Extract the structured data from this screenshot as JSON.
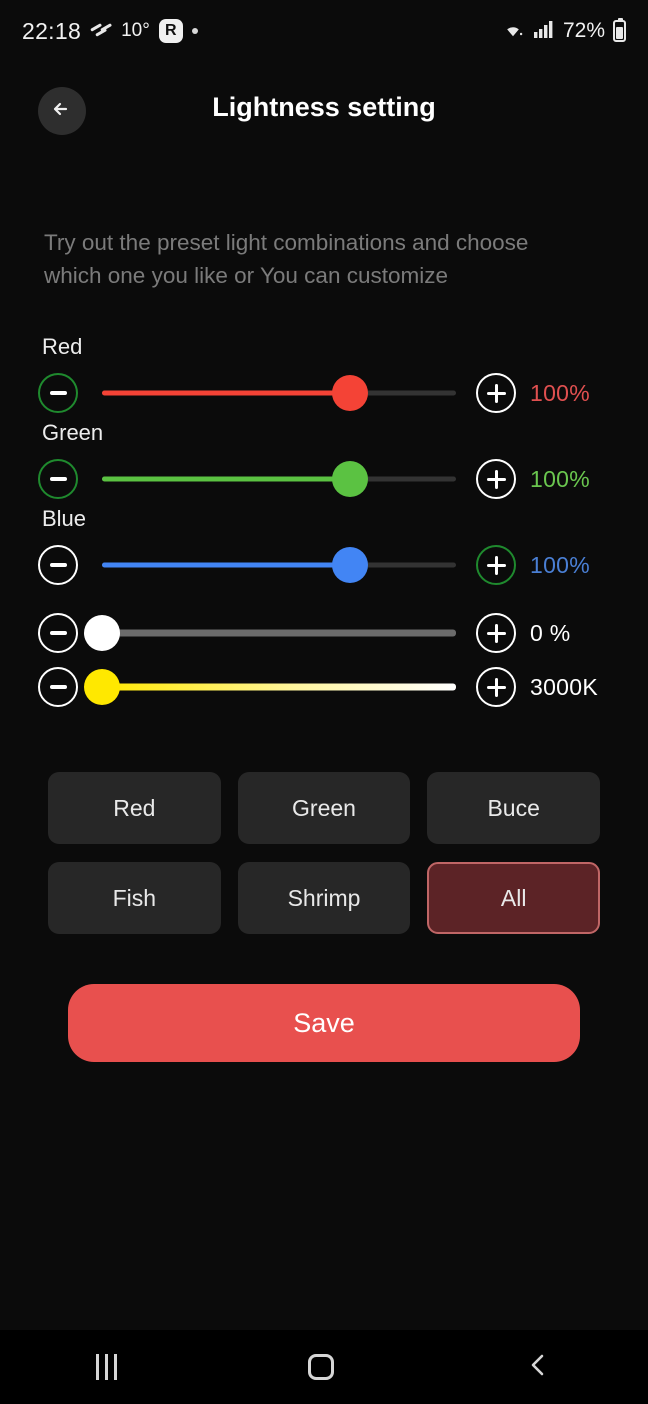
{
  "statusbar": {
    "time": "22:18",
    "weather_icon": "weather-haze-icon",
    "temperature": "10°",
    "app_badge": "R",
    "notification_dot": "•",
    "wifi_icon": "wifi-icon",
    "signal_icon": "cellular-signal-icon",
    "battery_percent": "72%",
    "battery_icon": "battery-icon"
  },
  "header": {
    "back_icon": "arrow-left-icon",
    "title": "Lightness setting"
  },
  "description": "Try out the preset light combinations and choose which one you like or You can customize",
  "sliders": [
    {
      "label": "Red",
      "value": "100%",
      "percent": 70,
      "color": "#f44336",
      "value_color": "#e05050",
      "minus_ring": "#1f8a2e",
      "plus_ring": "#ffffff",
      "minus_icon": "minus-icon",
      "plus_icon": "plus-icon"
    },
    {
      "label": "Green",
      "value": "100%",
      "percent": 70,
      "color": "#5bc242",
      "value_color": "#6ac64f",
      "minus_ring": "#1f8a2e",
      "plus_ring": "#ffffff",
      "minus_icon": "minus-icon",
      "plus_icon": "plus-icon"
    },
    {
      "label": "Blue",
      "value": "100%",
      "percent": 70,
      "color": "#4285f4",
      "value_color": "#4a7fd4",
      "minus_ring": "#ffffff",
      "plus_ring": "#1f8a2e",
      "minus_icon": "minus-icon",
      "plus_icon": "plus-icon"
    }
  ],
  "white_slider": {
    "label": "",
    "value": "0 %",
    "percent": 0,
    "thumb_color": "#ffffff",
    "track_color": "#6b6b6b",
    "value_color": "#ffffff",
    "minus_ring": "#ffffff",
    "plus_ring": "#ffffff",
    "minus_icon": "minus-icon",
    "plus_icon": "plus-icon"
  },
  "temperature_slider": {
    "label": "",
    "value": "3000K",
    "percent": 0,
    "thumb_color": "#ffe800",
    "gradient_from": "#ffe800",
    "gradient_to": "#ffffff",
    "value_color": "#ffffff",
    "minus_ring": "#ffffff",
    "plus_ring": "#ffffff",
    "minus_icon": "minus-icon",
    "plus_icon": "plus-icon"
  },
  "presets": [
    {
      "label": "Red",
      "selected": false
    },
    {
      "label": "Green",
      "selected": false
    },
    {
      "label": "Buce",
      "selected": false
    },
    {
      "label": "Fish",
      "selected": false
    },
    {
      "label": "Shrimp",
      "selected": false
    },
    {
      "label": "All",
      "selected": true
    }
  ],
  "save_button": {
    "label": "Save",
    "color": "#e8504e"
  },
  "navbar": {
    "recents_icon": "recents-icon",
    "home_icon": "home-icon",
    "back_icon": "chevron-left-icon"
  }
}
